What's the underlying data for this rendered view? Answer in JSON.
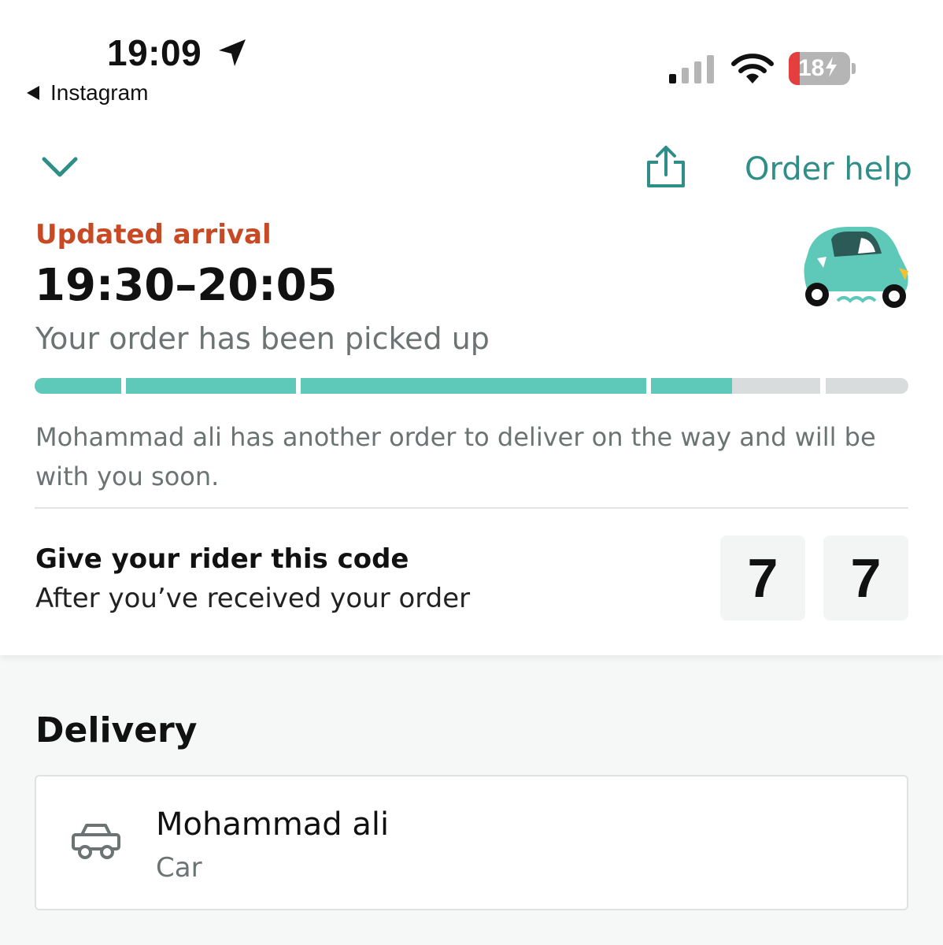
{
  "status_bar": {
    "time": "19:09",
    "back_app": "Instagram",
    "battery": "18",
    "battery_level": 0.18
  },
  "header": {
    "order_help": "Order help"
  },
  "arrival": {
    "label": "Updated arrival",
    "window": "19:30–20:05",
    "status": "Your order has been picked up",
    "progress": [
      1,
      1,
      1,
      0.48,
      0,
      0
    ]
  },
  "message": "Mohammad ali has another order to deliver on the way and will be with you soon.",
  "code": {
    "title": "Give your rider this code",
    "subtitle": "After you’ve received your order",
    "digits": [
      "7",
      "7"
    ]
  },
  "delivery": {
    "heading": "Delivery",
    "rider_name": "Mohammad ali",
    "vehicle": "Car"
  },
  "colors": {
    "accent": "#2f8f88",
    "progress_fill": "#5ec9b9",
    "alert": "#c84a24"
  }
}
